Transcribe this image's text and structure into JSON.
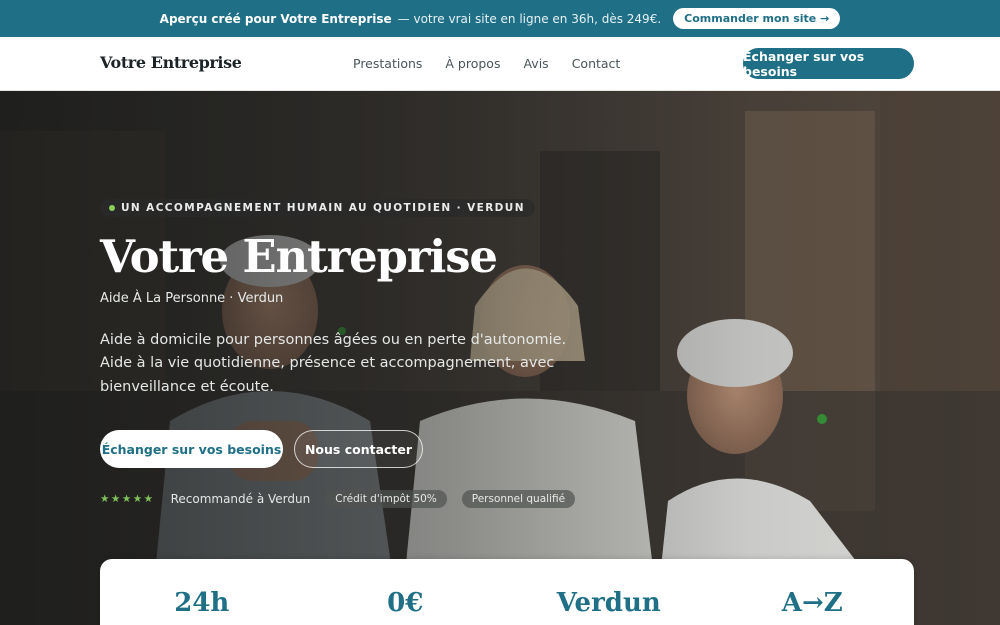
{
  "promo": {
    "lead": "Aperçu créé pour Votre Entreprise",
    "rest": "— votre vrai site en ligne en 36h, dès 249€.",
    "cta": "Commander mon site →"
  },
  "nav": {
    "brand": "Votre Entreprise",
    "items": [
      "Prestations",
      "À propos",
      "Avis",
      "Contact"
    ],
    "cta": "Échanger sur vos besoins"
  },
  "hero": {
    "eyebrow": "UN ACCOMPAGNEMENT HUMAIN AU QUOTIDIEN · VERDUN",
    "title": "Votre Entreprise",
    "subtitle": "Aide À La Personne · Verdun",
    "description": "Aide à domicile pour personnes âgées ou en perte d'autonomie. Aide à la vie quotidienne, présence et accompagnement, avec bienveillance et écoute.",
    "primary_cta": "Échanger sur vos besoins",
    "secondary_cta": "Nous contacter",
    "stars": "★★★★★",
    "recommendation": "Recommandé à Verdun",
    "badges": [
      "Crédit d'impôt 50%",
      "Personnel qualifié"
    ]
  },
  "stats": [
    "24h",
    "0€",
    "Verdun",
    "A→Z"
  ],
  "colors": {
    "accent": "#1f6f86",
    "star": "#7fc15a"
  }
}
